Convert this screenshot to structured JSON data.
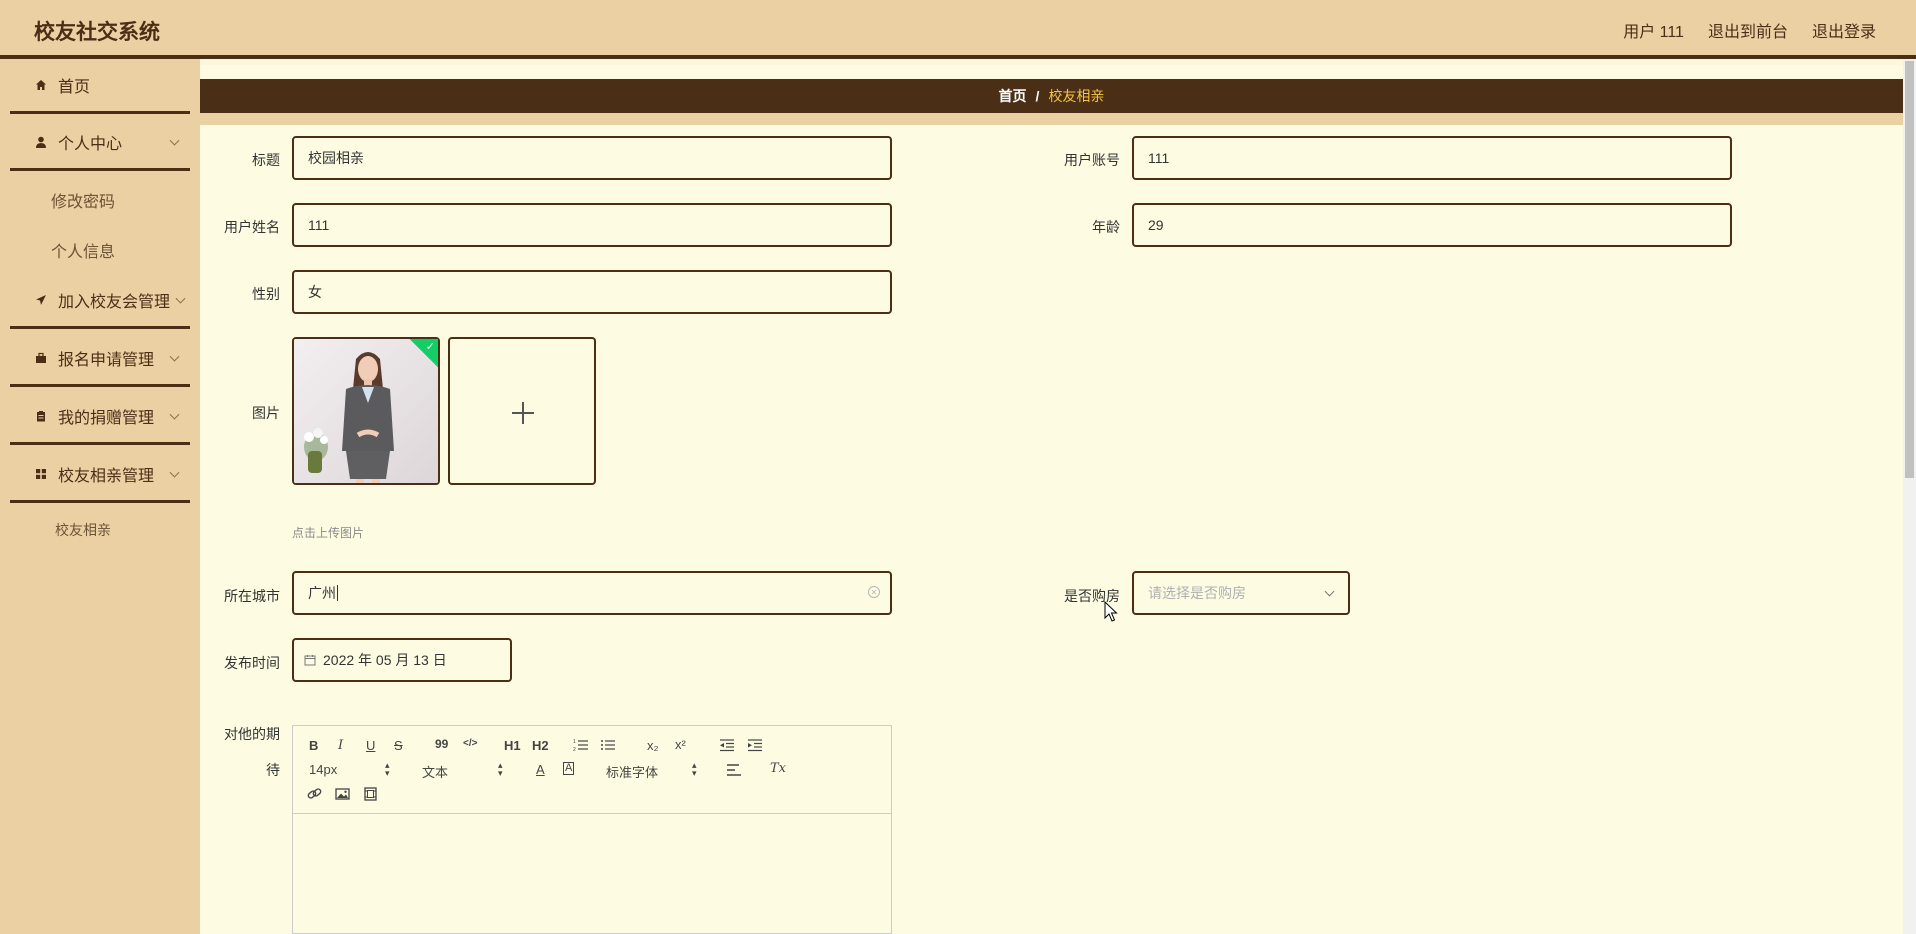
{
  "header": {
    "app_title": "校友社交系统",
    "user_label": "用户 111",
    "to_front_label": "退出到前台",
    "logout_label": "退出登录"
  },
  "sidebar": {
    "home": "首页",
    "personal_center": "个人中心",
    "change_password": "修改密码",
    "personal_info": "个人信息",
    "join_alumni": "加入校友会管理",
    "signup_mgmt": "报名申请管理",
    "donation_mgmt": "我的捐赠管理",
    "dating_mgmt": "校友相亲管理",
    "dating_sub": "校友相亲"
  },
  "breadcrumb": {
    "home": "首页",
    "separator": "/",
    "current": "校友相亲"
  },
  "form": {
    "title_label": "标题",
    "title_value": "校园相亲",
    "account_label": "用户账号",
    "account_value": "111",
    "name_label": "用户姓名",
    "name_value": "111",
    "age_label": "年龄",
    "age_value": "29",
    "gender_label": "性别",
    "gender_value": "女",
    "image_label": "图片",
    "upload_tip": "点击上传图片",
    "city_label": "所在城市",
    "city_value": "广州",
    "house_label": "是否购房",
    "house_placeholder": "请选择是否购房",
    "publish_label": "发布时间",
    "publish_value": "2022 年 05 月 13 日",
    "expect_label_line1": "对他的期",
    "expect_label_line2": "待"
  },
  "editor": {
    "bold": "B",
    "italic": "I",
    "underline": "U",
    "strike": "S",
    "quote": "99",
    "code": "</>",
    "h1": "H1",
    "h2": "H2",
    "sub": "x₂",
    "sup": "x²",
    "size_value": "14px",
    "header_value": "文本",
    "font_color": "A",
    "bg_color": "A",
    "font_family_value": "标准字体",
    "clear_format": "Tx"
  },
  "colors": {
    "header_bg": "#ebd0a4",
    "dark_brown": "#4a2f16",
    "page_bg": "#fdfce3",
    "accent_gold": "#f5c542",
    "success_green": "#13ce66"
  }
}
